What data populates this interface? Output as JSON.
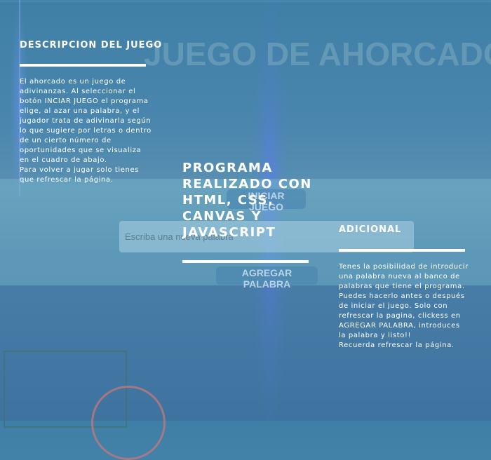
{
  "game_title": "JUEGO DE AHORCADO",
  "description": {
    "title": "DESCRIPCION DEL JUEGO",
    "lines": [
      "El ahorcado es un juego de",
      "adivinanzas. Al seleccionar el",
      "botón INCIAR JUEGO el programa",
      "elige, al azar una palabra, y el",
      "jugador trata de adivinarla según",
      "lo que sugiere por letras o dentro",
      "de un cierto número de",
      "oportunidades que se visualiza",
      "en el cuadro de abajo.",
      "Para volver a jugar solo tienes",
      "que refrescar la página."
    ]
  },
  "center": {
    "title_lines": [
      "PROGRAMA",
      "REALIZADO CON",
      "HTML, CSS,",
      "CANVAS Y",
      "JAVASCRIPT"
    ]
  },
  "start_button": {
    "label": "INICIAR JUEGO"
  },
  "word_input": {
    "placeholder": "Escriba una nueva palabra"
  },
  "add_button": {
    "label": "AGREGAR PALABRA"
  },
  "additional": {
    "title": "ADICIONAL",
    "lines": [
      "Tenes la posibilidad de introducir",
      "una palabra nueva al banco de",
      "palabras que tiene el programa.",
      "Puedes hacerlo antes o después",
      "de iniciar el juego. Solo con",
      "refrescar la pagina, clickess en",
      "AGREGAR PALABRA, introduces",
      "la palabra y listo!!",
      "Recuerda refrescar la página."
    ]
  },
  "colors": {
    "background": "#4a86ad",
    "band": "#78b9cd",
    "text": "#ffffff",
    "title_watermark": "#6ea0b9"
  }
}
